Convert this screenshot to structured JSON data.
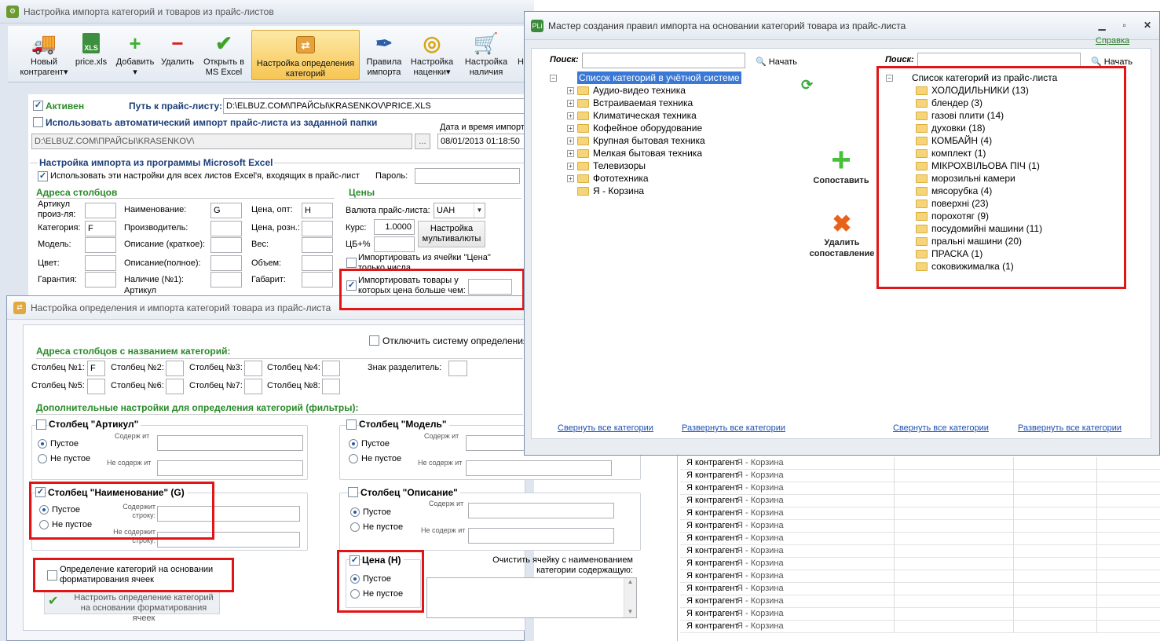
{
  "main_window": {
    "title": "Настройка импорта категорий и товаров из прайс-листов",
    "toolbar": [
      {
        "label": "Новый контрагент",
        "icon": "truck-icon"
      },
      {
        "label": "price.xls",
        "icon": "excel-file-icon"
      },
      {
        "label": "Добавить",
        "icon": "plus-icon"
      },
      {
        "label": "Удалить",
        "icon": "minus-icon"
      },
      {
        "label": "Открыть в MS Excel",
        "icon": "check-icon"
      },
      {
        "label": "Настройка определения категорий",
        "icon": "category-settings-icon"
      },
      {
        "label": "Правила импорта",
        "icon": "feather-icon"
      },
      {
        "label": "Настройка наценки",
        "icon": "coins-icon"
      },
      {
        "label": "Настройка наличия",
        "icon": "cart-icon"
      },
      {
        "label": "Н",
        "icon": "more-icon"
      }
    ],
    "active_label": "Активен",
    "path_label": "Путь к прайс-листу:",
    "path_value": "D:\\ELBUZ.COM\\ПРАЙСЫ\\KRASENKOV\\PRICE.XLS",
    "auto_import_label": "Использовать автоматический импорт прайс-листа из заданной папки",
    "auto_import_path": "D:\\ELBUZ.COM\\ПРАЙСЫ\\KRASENKOV\\",
    "browse_label": "...",
    "datetime_label": "Дата и время импорт",
    "datetime_value": "08/01/2013 01:18:50",
    "excel_section": "Настройка импорта из программы Microsoft Excel",
    "use_all_sheets": "Использовать эти настройки для всех листов Excel'я, входящих в прайс-лист",
    "password_label": "Пароль:",
    "columns_header": "Адреса столбцов",
    "prices_header": "Цены",
    "col_fields": [
      {
        "label": "Артикул произ-ля:",
        "value": ""
      },
      {
        "label": "Категория:",
        "value": "F"
      },
      {
        "label": "Модель:",
        "value": ""
      },
      {
        "label": "Цвет:",
        "value": ""
      },
      {
        "label": "Гарантия:",
        "value": ""
      },
      {
        "label": "Наименование:",
        "value": "G"
      },
      {
        "label": "Производитель:",
        "value": ""
      },
      {
        "label": "Описание (краткое):",
        "value": ""
      },
      {
        "label": "Описание(полное):",
        "value": ""
      },
      {
        "label": "Наличие (№1):",
        "value": ""
      },
      {
        "label": "Цена, опт:",
        "value": "H"
      },
      {
        "label": "Цена, розн.:",
        "value": ""
      },
      {
        "label": "Вес:",
        "value": ""
      },
      {
        "label": "Объем:",
        "value": ""
      },
      {
        "label": "Габарит:",
        "value": ""
      }
    ],
    "artikul_cut": "Артикул",
    "currency_label": "Валюта прайс-листа:",
    "currency_value": "UAH",
    "rate_label": "Курс:",
    "rate_value": "1.0000",
    "cb_label": "ЦБ+%",
    "multicurrency_btn": "Настройка мультивалюты",
    "import_from_price_cell": "Импортировать из ячейки \"Цена\" только числа",
    "import_price_greater": "Импортировать товары у которых цена больше чем:"
  },
  "cat_window": {
    "title": "Настройка определения и импорта категорий товара из прайс-листа",
    "disable_system": "Отключить систему определения к",
    "addresses_header": "Адреса столбцов с названием категорий:",
    "columns": [
      {
        "label": "Столбец №1:",
        "value": "F"
      },
      {
        "label": "Столбец №2:",
        "value": ""
      },
      {
        "label": "Столбец №3:",
        "value": ""
      },
      {
        "label": "Столбец №4:",
        "value": ""
      },
      {
        "label": "Столбец №5:",
        "value": ""
      },
      {
        "label": "Столбец №6:",
        "value": ""
      },
      {
        "label": "Столбец №7:",
        "value": ""
      },
      {
        "label": "Столбец №8:",
        "value": ""
      }
    ],
    "separator_label": "Знак разделитель:",
    "filters_header": "Дополнительные настройки для определения категорий (фильтры):",
    "groups": [
      {
        "title": "Столбец \"Артикул\"",
        "checked": false
      },
      {
        "title": "Столбец \"Модель\"",
        "checked": false
      },
      {
        "title": "Столбец \"Наименование\" (G)",
        "checked": true
      },
      {
        "title": "Столбец \"Описание\"",
        "checked": false
      },
      {
        "title": "Цена (H)",
        "checked": true
      }
    ],
    "empty": "Пустое",
    "not_empty": "Не пустое",
    "contains": "Содержит строку:",
    "not_contains": "Не содержит строку:",
    "contains_short": "Содерж ит",
    "not_contains_short": "Не содерж ит",
    "format_detect": "Определение категорий на основании форматирования ячеек",
    "format_btn": "Настроить определение категорий на основании форматирования ячеек",
    "clear_cell_label": "Очистить ячейку с наименованием категории содержащую:"
  },
  "wizard": {
    "title": "Мастер создания правил импорта на основании категорий товара из прайс-листа",
    "help": "Справка",
    "search_label": "Поиск:",
    "start_label": "Начать",
    "left_root": "Список категорий в учётной системе",
    "left_items": [
      "Аудио-видео техника",
      "Встраиваемая техника",
      "Климатическая техника",
      "Кофейное оборудование",
      "Крупная бытовая техника",
      "Мелкая бытовая техника",
      "Телевизоры",
      "Фототехника",
      "Я - Корзина"
    ],
    "right_root": "Список категорий из прайс-листа",
    "right_items": [
      "ХОЛОДИЛЬНИКИ (13)",
      "блендер (3)",
      "газові плити (14)",
      "духовки (18)",
      "КОМБАЙН (4)",
      "комплект (1)",
      "МІКРОХВІЛЬОВА ПІЧ (1)",
      "морозильні камери",
      "мясорубка (4)",
      "поверхні (23)",
      "порохотяг (9)",
      "посудомийні машини (11)",
      "пральні машини (20)",
      "ПРАСКА (1)",
      "соковижималка (1)"
    ],
    "match_btn": "Сопоставить",
    "unmatch_btn": "Удалить сопоставление",
    "collapse_all": "Свернуть все категории",
    "expand_all": "Развернуть все категории"
  },
  "grid": {
    "rows": [
      {
        "col1": "Я контрагент",
        "col2": "Я - Корзина"
      },
      {
        "col1": "Я контрагент",
        "col2": "Я - Корзина"
      },
      {
        "col1": "Я контрагент",
        "col2": "Я - Корзина"
      },
      {
        "col1": "Я контрагент",
        "col2": "Я - Корзина"
      },
      {
        "col1": "Я контрагент",
        "col2": "Я - Корзина"
      },
      {
        "col1": "Я контрагент",
        "col2": "Я - Корзина"
      },
      {
        "col1": "Я контрагент",
        "col2": "Я - Корзина"
      },
      {
        "col1": "Я контрагент",
        "col2": "Я - Корзина"
      },
      {
        "col1": "Я контрагент",
        "col2": "Я - Корзина"
      },
      {
        "col1": "Я контрагент",
        "col2": "Я - Корзина"
      },
      {
        "col1": "Я контрагент",
        "col2": "Я - Корзина"
      },
      {
        "col1": "Я контрагент",
        "col2": "Я - Корзина"
      },
      {
        "col1": "Я контрагент",
        "col2": "Я - Корзина"
      },
      {
        "col1": "Я контрагент",
        "col2": "Я - Корзина"
      }
    ]
  }
}
